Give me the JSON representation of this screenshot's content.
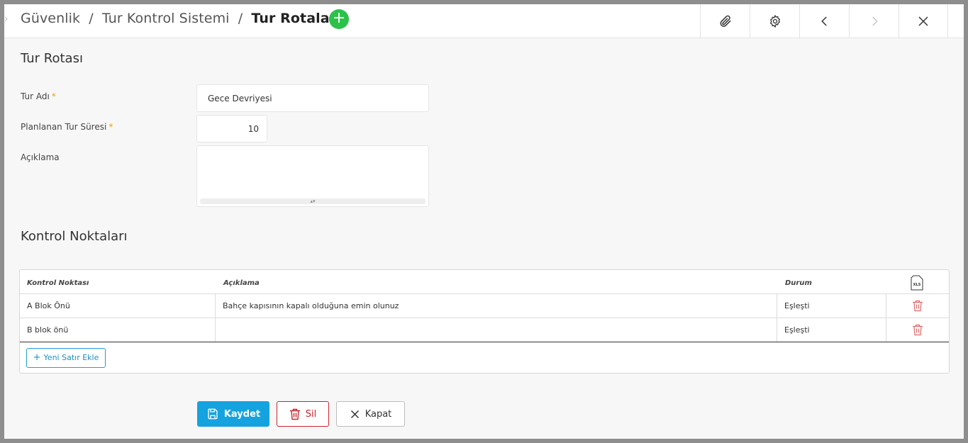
{
  "header": {
    "breadcrumb_1": "Güvenlik",
    "breadcrumb_2": "Tur Kontrol Sistemi",
    "breadcrumb_current": "Tur Rotaları",
    "separator": "/",
    "add_symbol": "+",
    "tools": [
      "paperclip-icon",
      "gear-icon",
      "chevron-left-icon",
      "chevron-right-icon",
      "close-icon"
    ]
  },
  "form": {
    "section_title": "Tur Rotası",
    "tour_name_label": "Tur Adı",
    "tour_name_value": "Gece Devriyesi",
    "duration_label": "Planlanan Tur Süresi",
    "duration_value": "10",
    "description_label": "Açıklama",
    "description_value": "",
    "required_mark": "*"
  },
  "checkpoints": {
    "section_title": "Kontrol Noktaları",
    "columns": [
      "Kontrol Noktası",
      "Açıklama",
      "Durum"
    ],
    "export_icon_text": "XLS",
    "rows": [
      {
        "checkpoint": "A Blok Önü",
        "description": "Bahçe kapısının kapalı olduğuna emin olunuz",
        "status": "Eşleşti"
      },
      {
        "checkpoint": "B blok önü",
        "description": "",
        "status": "Eşleşti"
      }
    ],
    "add_row_label": "Yeni Satır Ekle"
  },
  "actions": {
    "save_label": "Kaydet",
    "delete_label": "Sil",
    "close_label": "Kapat"
  },
  "colors": {
    "accent": "#14a3de",
    "add_button": "#2cc24a",
    "danger": "#c8232c",
    "required": "#f0a000"
  }
}
